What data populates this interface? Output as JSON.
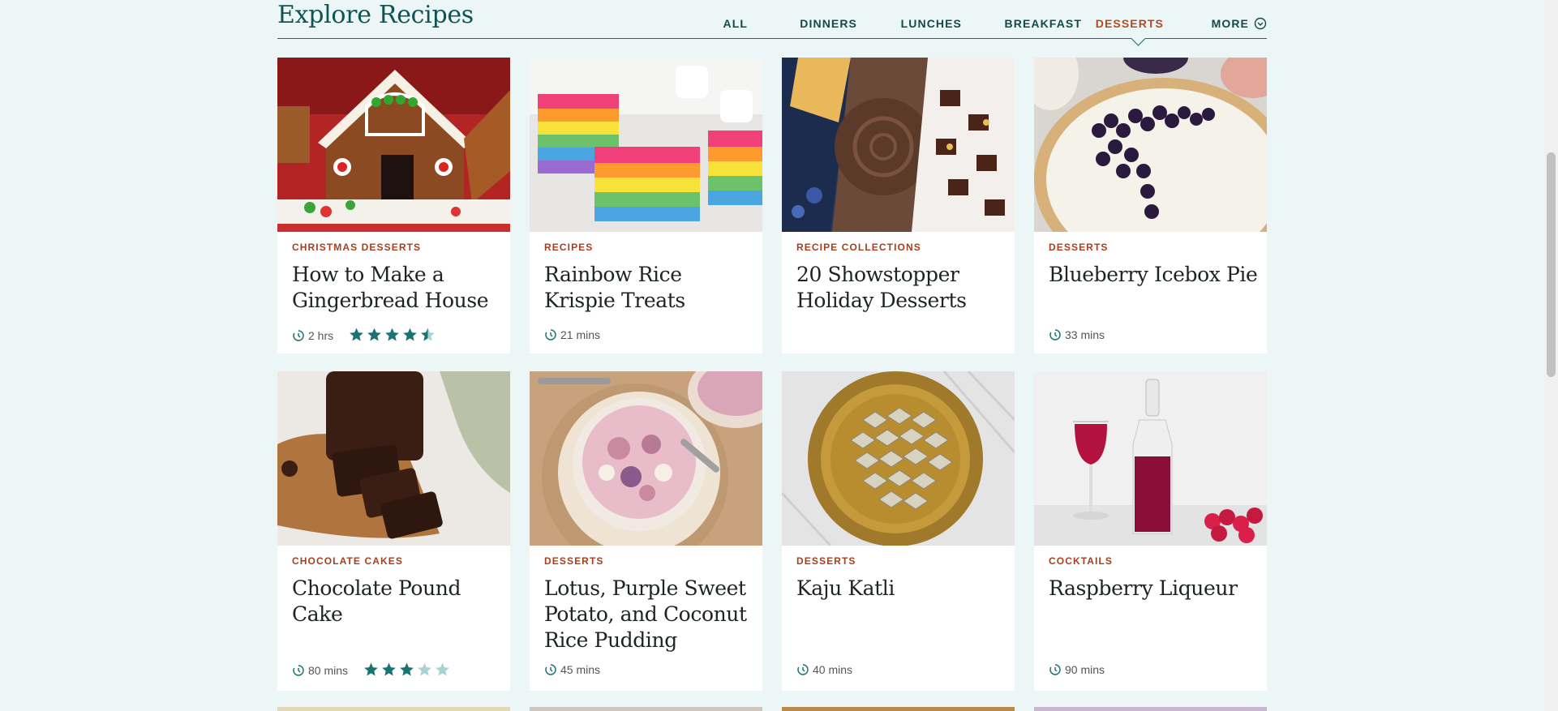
{
  "section": {
    "title": "Explore Recipes"
  },
  "tabs": [
    {
      "label": "ALL",
      "active": false
    },
    {
      "label": "DINNERS",
      "active": false
    },
    {
      "label": "LUNCHES",
      "active": false
    },
    {
      "label": "BREAKFAST",
      "active": false
    },
    {
      "label": "DESSERTS",
      "active": true
    },
    {
      "label": "MORE",
      "active": false
    }
  ],
  "cards": [
    {
      "category": "CHRISTMAS DESSERTS",
      "title": "How to Make a Gingerbread House",
      "time": "2 hrs",
      "rating": 4.5,
      "image": "gingerbread-house"
    },
    {
      "category": "RECIPES",
      "title": "Rainbow Rice Krispie Treats",
      "time": "21 mins",
      "image": "rainbow-treats"
    },
    {
      "category": "RECIPE COLLECTIONS",
      "title": "20 Showstopper Holiday Desserts",
      "image": "holiday-desserts"
    },
    {
      "category": "DESSERTS",
      "title": "Blueberry Icebox Pie",
      "time": "33 mins",
      "image": "blueberry-pie"
    },
    {
      "category": "CHOCOLATE CAKES",
      "title": "Chocolate Pound Cake",
      "time": "80 mins",
      "rating": 3,
      "image": "chocolate-pound-cake"
    },
    {
      "category": "DESSERTS",
      "title": "Lotus, Purple Sweet Potato, and Coconut Rice Pudding",
      "time": "45 mins",
      "image": "rice-pudding"
    },
    {
      "category": "DESSERTS",
      "title": "Kaju Katli",
      "time": "40 mins",
      "image": "kaju-katli"
    },
    {
      "category": "COCKTAILS",
      "title": "Raspberry Liqueur",
      "time": "90 mins",
      "image": "raspberry-liqueur"
    }
  ],
  "colors": {
    "accent": "#0f5454",
    "active_tab": "#b24a21",
    "category": "#a83e1d",
    "star": "#1a7373",
    "star_empty": "#a9d3d3"
  }
}
